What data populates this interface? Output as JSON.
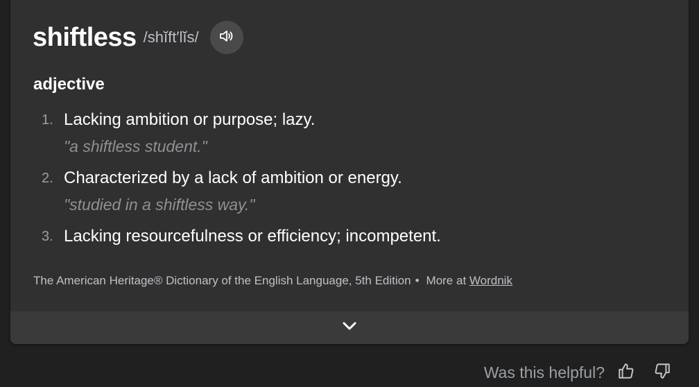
{
  "entry": {
    "headword": "shiftless",
    "pronunciation": "/shĭft′lĭs/",
    "audio_icon": "speaker-icon",
    "part_of_speech": "adjective",
    "definitions": [
      {
        "number": "1.",
        "text": "Lacking ambition or purpose; lazy.",
        "example": "\"a shiftless student.\""
      },
      {
        "number": "2.",
        "text": "Characterized by a lack of ambition or energy.",
        "example": "\"studied in a shiftless way.\""
      },
      {
        "number": "3.",
        "text": "Lacking resourcefulness or efficiency; incompetent.",
        "example": ""
      }
    ]
  },
  "source": {
    "dictionary": "The American Heritage® Dictionary of the English Language, 5th Edition",
    "separator": "•",
    "more_prefix": "More at",
    "more_link": "Wordnik"
  },
  "expand": {
    "icon": "chevron-down-icon"
  },
  "feedback": {
    "label": "Was this helpful?",
    "thumbs_up_icon": "thumbs-up-icon",
    "thumbs_down_icon": "thumbs-down-icon"
  },
  "colors": {
    "page_bg": "#202020",
    "card_bg": "#303030",
    "expand_bar_bg": "#3a3a3a",
    "audio_button_bg": "#4a4a4a",
    "text_primary": "#ffffff",
    "text_secondary": "#bdc1c6",
    "text_example": "#8e9196"
  }
}
